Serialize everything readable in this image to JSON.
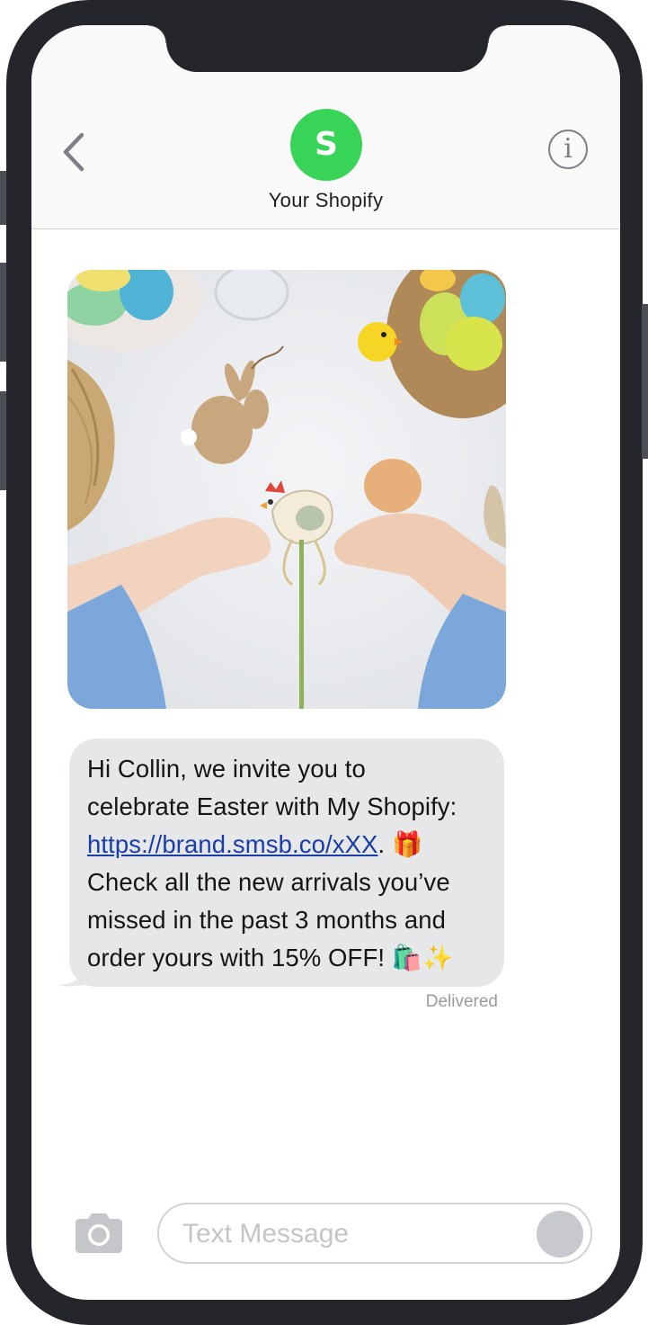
{
  "contact": {
    "initial": "S",
    "name": "Your Shopify",
    "avatar_color": "#38d458"
  },
  "header": {
    "back_icon": "chevron-left-icon",
    "info_icon": "info-circle-icon",
    "info_glyph": "i"
  },
  "message": {
    "line1": "Hi Collin, we invite you to",
    "line2": "celebrate Easter with My Shopify:",
    "link": "https://brand.smsb.co/xXX",
    "after_link": ".",
    "gift_emoji": "🎁",
    "line4": "Check all the new arrivals you’ve",
    "line5": "missed in the past 3 months and",
    "line6": "order yours with 15% OFF!",
    "end_emoji": "🛍️✨",
    "status": "Delivered"
  },
  "composer": {
    "placeholder": "Text Message",
    "camera_icon": "camera-icon",
    "send_icon": "send-icon"
  },
  "colors": {
    "frame": "#25262b",
    "bubble": "#e6e7e9",
    "link": "#1a3ea8"
  }
}
